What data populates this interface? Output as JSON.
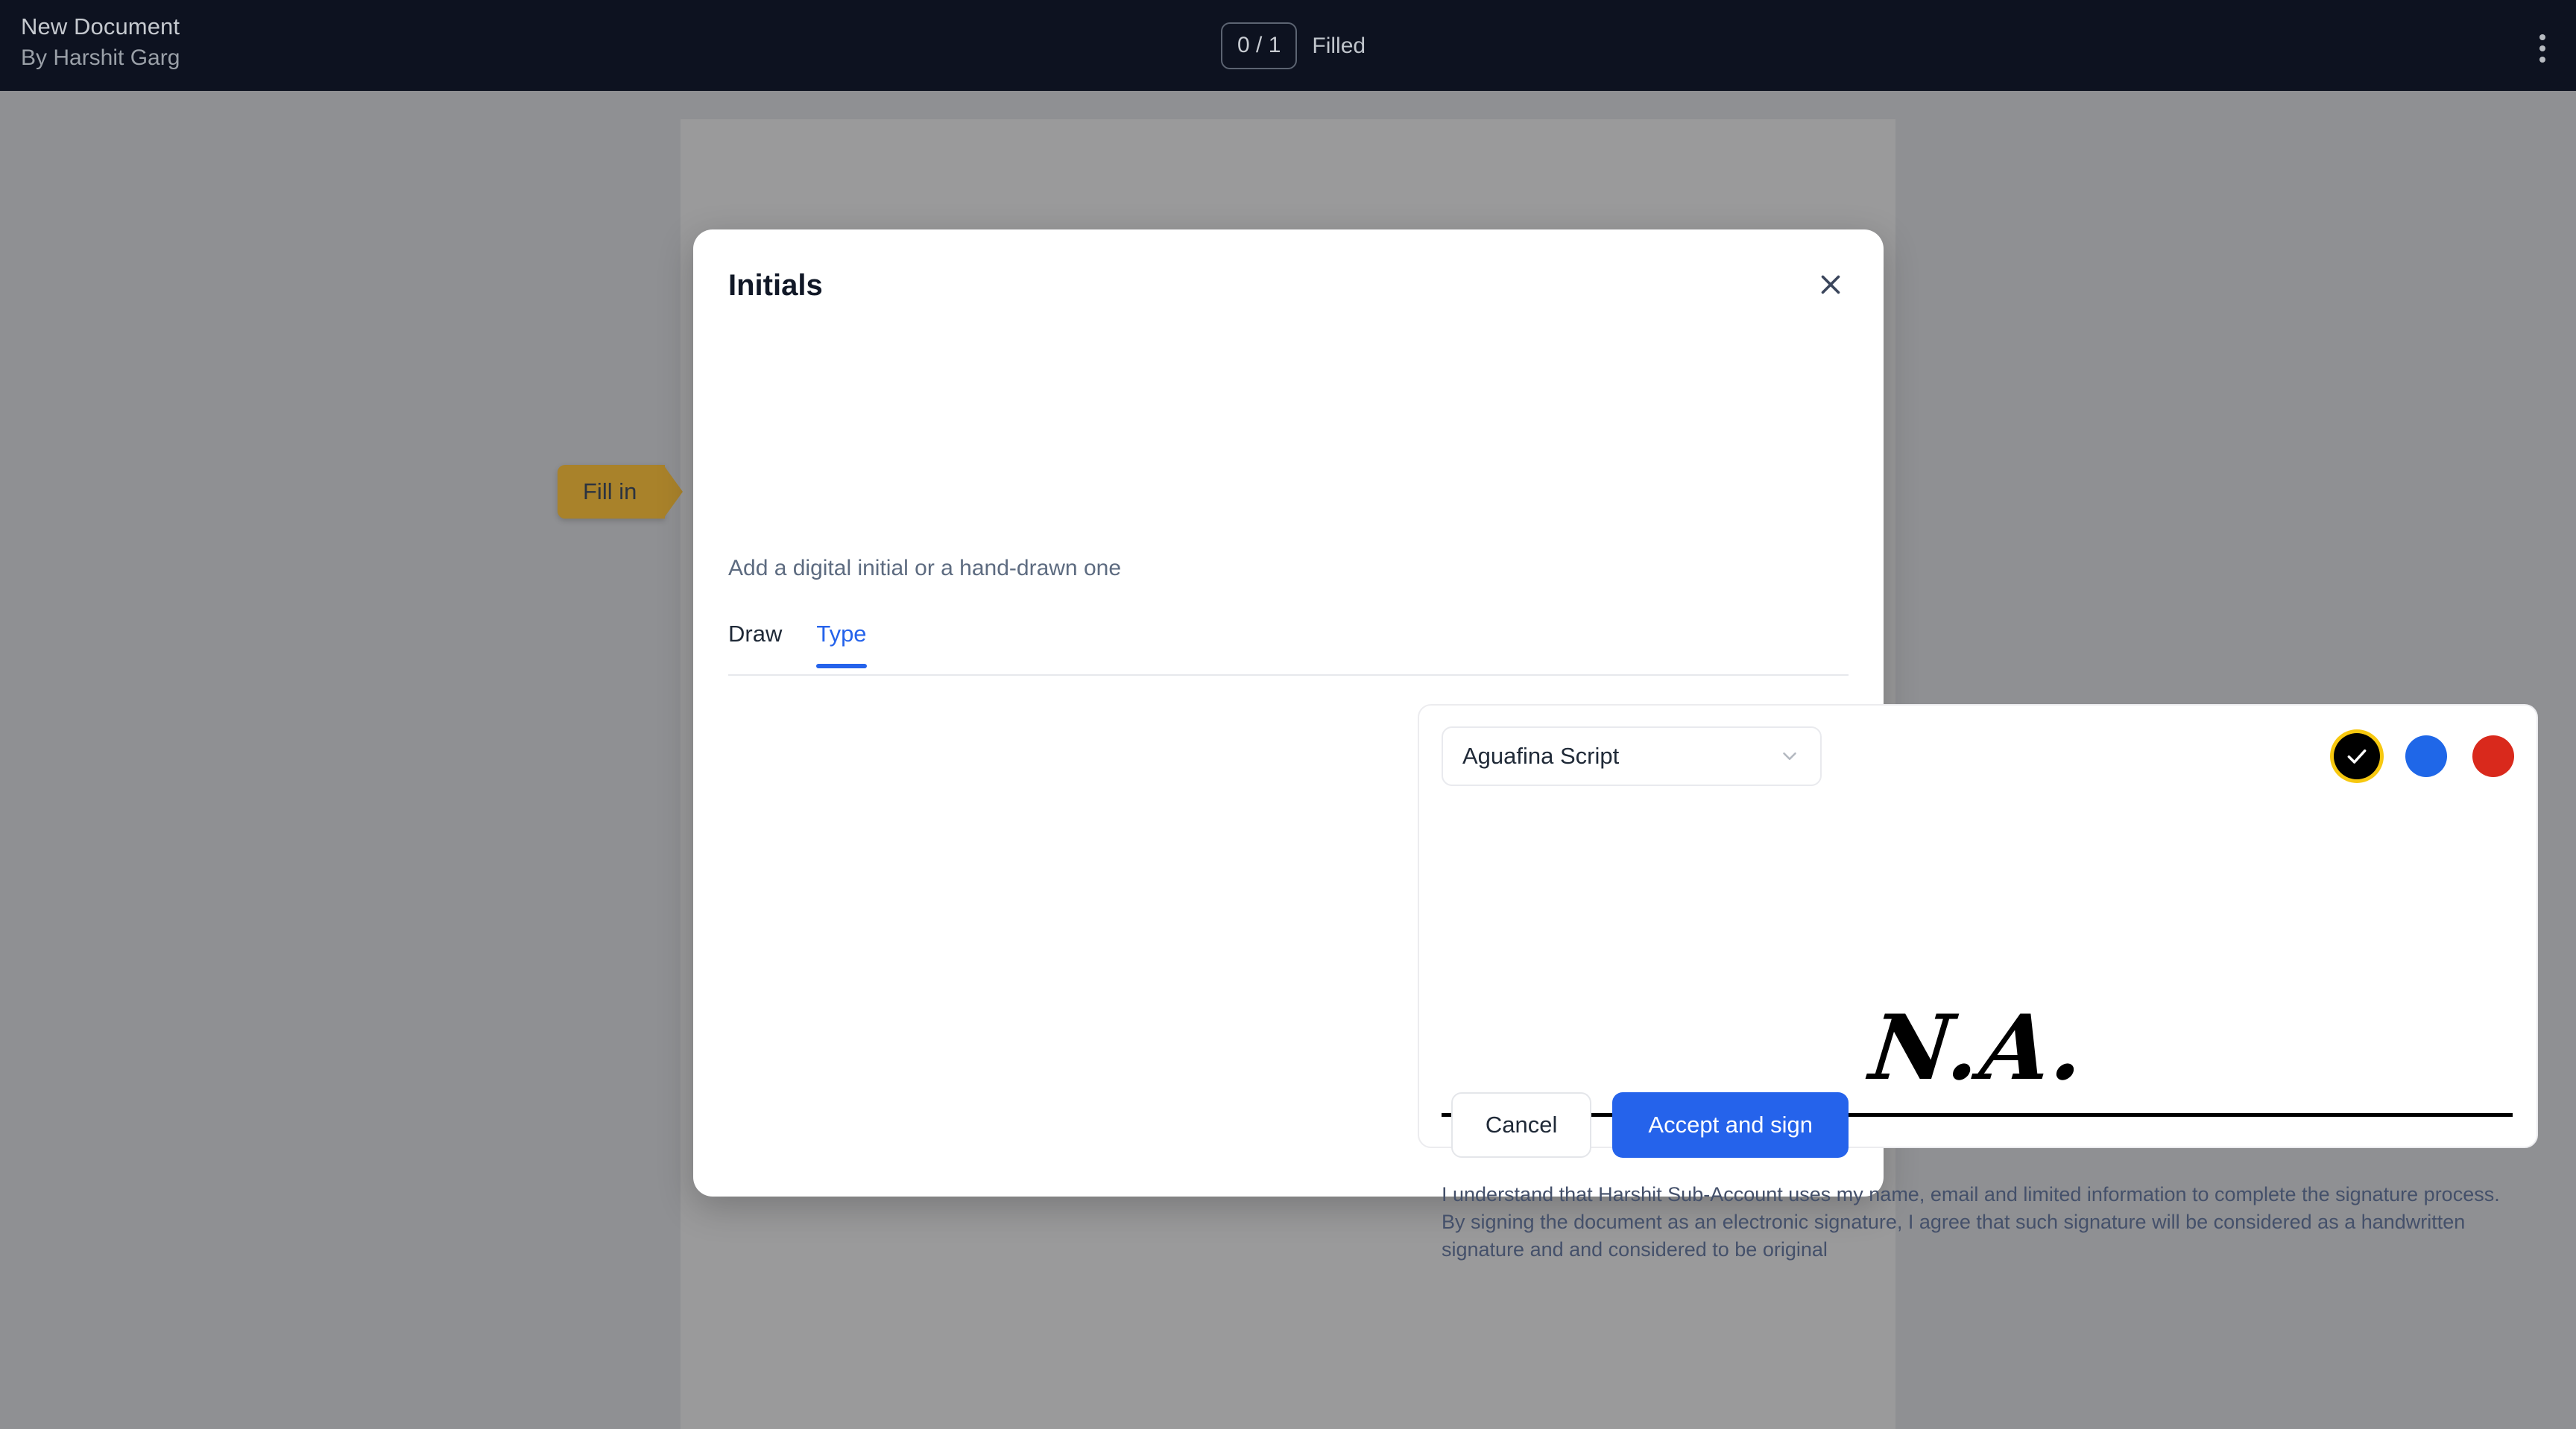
{
  "header": {
    "document_title": "New Document",
    "author": "By Harshit Garg",
    "filled_count": "0 / 1",
    "filled_label": "Filled",
    "menu_icon": "kebab-menu-icon"
  },
  "document": {
    "fill_in_tag": "Fill in"
  },
  "modal": {
    "title": "Initials",
    "subtitle": "Add a digital initial or a hand-drawn one",
    "close_icon": "close-icon",
    "tabs": [
      {
        "label": "Draw",
        "active": false
      },
      {
        "label": "Type",
        "active": true
      }
    ],
    "font_select": {
      "value": "Aguafina Script",
      "chevron_icon": "chevron-down-icon"
    },
    "colors": [
      {
        "name": "black",
        "hex": "#000000",
        "selected": true
      },
      {
        "name": "blue",
        "hex": "#1f67e8",
        "selected": false
      },
      {
        "name": "red",
        "hex": "#d9291c",
        "selected": false
      }
    ],
    "selection_ring_color": "#f7c80f",
    "signature_preview": "N.A.",
    "disclaimer": "I understand that Harshit Sub-Account uses my name, email and limited information to complete the signature process. By signing the document as an electronic signature, I agree that such signature will be considered as a handwritten signature and and considered to be original",
    "cancel_label": "Cancel",
    "accept_label": "Accept and sign",
    "accent_color": "#2563eb"
  }
}
